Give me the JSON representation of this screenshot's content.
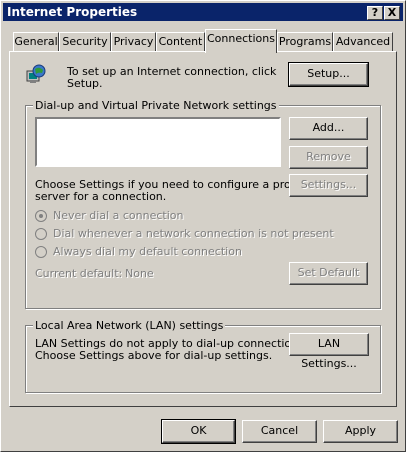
{
  "window": {
    "title": "Internet Properties",
    "help_button": "?",
    "close_button": "X"
  },
  "tabs": [
    {
      "label": "General"
    },
    {
      "label": "Security"
    },
    {
      "label": "Privacy"
    },
    {
      "label": "Content"
    },
    {
      "label": "Connections",
      "active": true
    },
    {
      "label": "Programs"
    },
    {
      "label": "Advanced"
    }
  ],
  "setup": {
    "text_line1": "To set up an Internet connection, click",
    "text_line2": "Setup.",
    "button": "Setup...",
    "icon": "globe-computer-icon"
  },
  "dialup": {
    "group_label": "Dial-up and Virtual Private Network settings",
    "add_button": "Add...",
    "remove_button": "Remove",
    "settings_button": "Settings...",
    "instruction_line1": "Choose Settings if you need to configure a proxy",
    "instruction_line2": "server for a connection.",
    "radio_never": "Never dial a connection",
    "radio_whenever": "Dial whenever a network connection is not present",
    "radio_always": "Always dial my default connection",
    "current_default_label": "Current default:",
    "current_default_value": "None",
    "set_default_button": "Set Default"
  },
  "lan": {
    "group_label": "Local Area Network (LAN) settings",
    "text_line1": "LAN Settings do not apply to dial-up connections.",
    "text_line2": "Choose Settings above for dial-up settings.",
    "button": "LAN Settings..."
  },
  "footer": {
    "ok": "OK",
    "cancel": "Cancel",
    "apply": "Apply"
  },
  "colors": {
    "face": "#d4d0c8",
    "titlebar": "#0a246a"
  }
}
